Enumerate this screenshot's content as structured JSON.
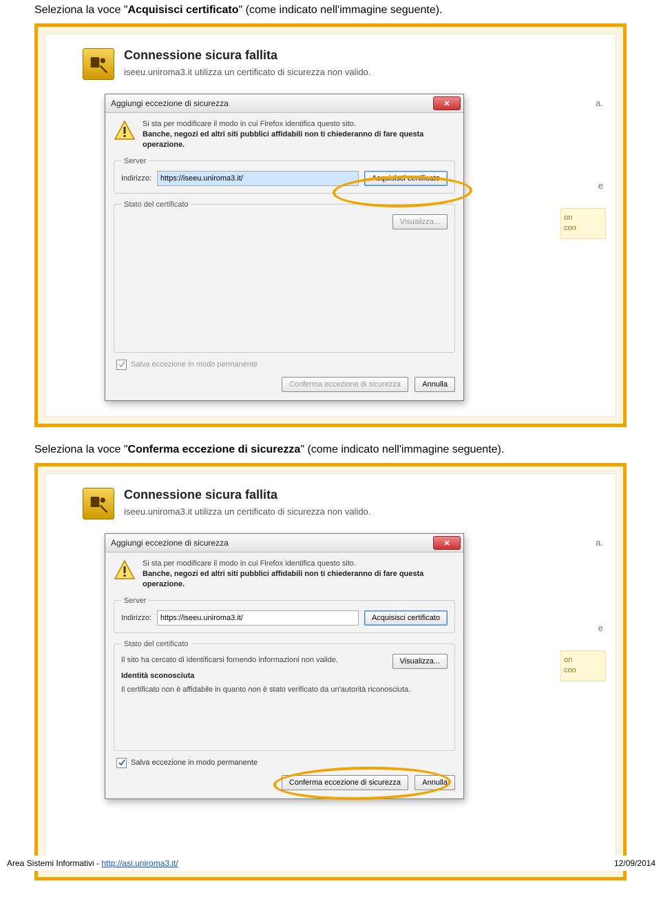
{
  "instr1_pre": "Seleziona la voce \"",
  "instr1_bold": "Acquisisci certificato",
  "instr1_post": "\" (come indicato nell'immagine seguente).",
  "instr2_pre": "Seleziona la voce \"",
  "instr2_bold": "Conferma eccezione di sicurezza",
  "instr2_post": "\" (come indicato nell'immagine seguente).",
  "err_title": "Connessione sicura fallita",
  "err_sub": "iseeu.uniroma3.it utilizza un certificato di sicurezza non valido.",
  "dlg_title": "Aggiungi eccezione di sicurezza",
  "warn_line1": "Si sta per modificare il modo in cui Firefox identifica questo sito.",
  "warn_line2": "Banche, negozi ed altri siti pubblici affidabili non ti chiederanno di fare questa operazione.",
  "fs_server": "Server",
  "lbl_indirizzo": "Indirizzo:",
  "url_value": "https://iseeu.uniroma3.it/",
  "btn_acquisisci": "Acquisisci certificato",
  "fs_stato": "Stato del certificato",
  "btn_visualizza": "Visualizza...",
  "stato_line1": "Il sito ha cercato di identificarsi fornendo informazioni non valide.",
  "stato_head": "Identità sconosciuta",
  "stato_line2": "Il certificato non è affidabile in quanto non è stato verificato da un'autorità riconosciuta.",
  "chk_salva": "Salva eccezione in modo permanente",
  "btn_conferma": "Conferma eccezione di sicurezza",
  "btn_annulla": "Annulla",
  "trail_a": "a.",
  "trail_e": "e",
  "note_on": "on",
  "note_con": "con",
  "footer_left_pre": "Area Sistemi Informativi - ",
  "footer_link": "http://asi.uniroma3.it/",
  "footer_date": "12/09/2014"
}
